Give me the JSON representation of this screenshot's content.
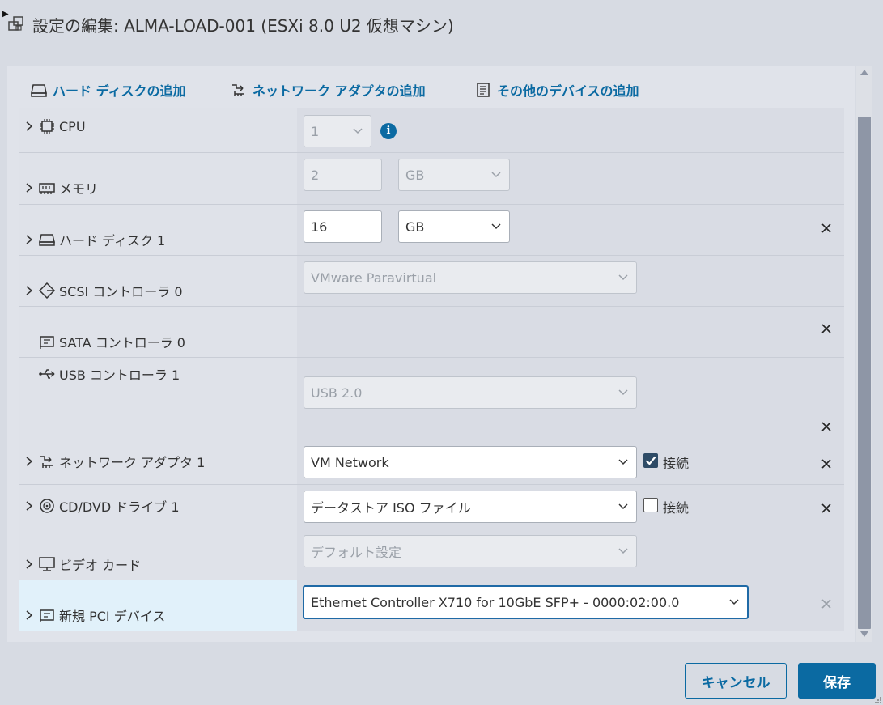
{
  "window": {
    "title": "設定の編集: ALMA-LOAD-001 (ESXi 8.0 U2 仮想マシン)"
  },
  "add_bar": {
    "add_hard_disk": "ハード ディスクの追加",
    "add_network_adapter": "ネットワーク アダプタの追加",
    "add_other_device": "その他のデバイスの追加"
  },
  "devices": {
    "cpu": {
      "label": "CPU",
      "value": "1"
    },
    "memory": {
      "label": "メモリ",
      "value": "2",
      "unit": "GB"
    },
    "hard_disk": {
      "label": "ハード ディスク 1",
      "value": "16",
      "unit": "GB"
    },
    "scsi": {
      "label": "SCSI コントローラ 0",
      "value": "VMware Paravirtual"
    },
    "sata": {
      "label": "SATA コントローラ 0"
    },
    "usb": {
      "label": "USB コントローラ 1",
      "value": "USB 2.0"
    },
    "network": {
      "label": "ネットワーク アダプタ 1",
      "value": "VM Network",
      "connect_label": "接続",
      "connected": true
    },
    "cdrom": {
      "label": "CD/DVD ドライブ 1",
      "value": "データストア ISO ファイル",
      "connect_label": "接続",
      "connected": false
    },
    "video": {
      "label": "ビデオ カード",
      "value": "デフォルト設定"
    },
    "pci": {
      "label": "新規 PCI デバイス",
      "value": "Ethernet Controller X710 for 10GbE SFP+ - 0000:02:00.0"
    }
  },
  "footer": {
    "cancel_label": "キャンセル",
    "save_label": "保存"
  },
  "colors": {
    "accent": "#0b6aa2",
    "background": "#d7dbe3",
    "highlight_row": "#e1f1fa"
  }
}
